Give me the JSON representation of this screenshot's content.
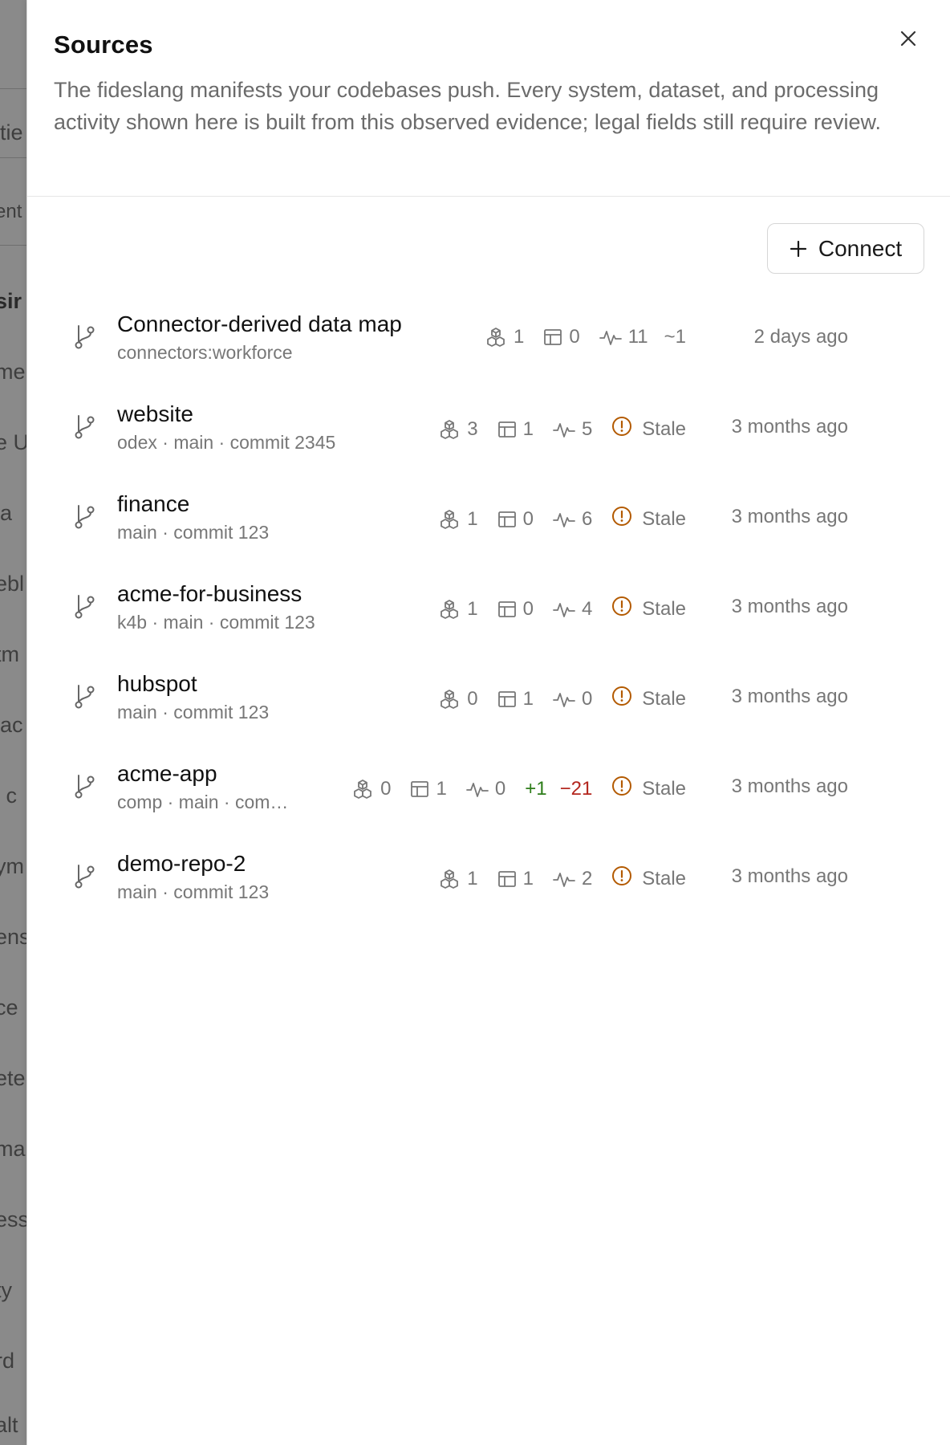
{
  "backdrop": {
    "fragments": [
      "itie",
      "ent",
      "sir",
      "me",
      "e U",
      "la ",
      "ebl",
      "tm",
      "lac",
      "l c",
      "ym",
      "ens",
      "ce ",
      "ete",
      "ma",
      "ess",
      "ty ",
      "rd ",
      "alt"
    ]
  },
  "panel": {
    "title": "Sources",
    "description": "The fideslang manifests your codebases push. Every system, dataset, and processing activity shown here is built from this observed evidence; legal fields still require review.",
    "close_icon": "close-icon",
    "connect_label": "Connect",
    "connect_icon": "plus-icon"
  },
  "colors": {
    "stale": "#b35a00",
    "plus": "#2e7d1a",
    "minus": "#b3261e",
    "muted": "#777777"
  },
  "sources": [
    {
      "name": "Connector-derived data map",
      "sub": "connectors:workforce",
      "systems": "1",
      "datasets": "0",
      "activity": "11",
      "approx": "~1",
      "stale": false,
      "time": "2 days ago"
    },
    {
      "name": "website",
      "sub": "odex · main · commit 2345",
      "systems": "3",
      "datasets": "1",
      "activity": "5",
      "stale": true,
      "stale_label": "Stale",
      "time": "3 months ago"
    },
    {
      "name": "finance",
      "sub": "main · commit 123",
      "systems": "1",
      "datasets": "0",
      "activity": "6",
      "stale": true,
      "stale_label": "Stale",
      "time": "3 months ago"
    },
    {
      "name": "acme-for-business",
      "sub": "k4b · main · commit 123",
      "systems": "1",
      "datasets": "0",
      "activity": "4",
      "stale": true,
      "stale_label": "Stale",
      "time": "3 months ago"
    },
    {
      "name": "hubspot",
      "sub": "main · commit 123",
      "systems": "0",
      "datasets": "1",
      "activity": "0",
      "stale": true,
      "stale_label": "Stale",
      "time": "3 months ago"
    },
    {
      "name": "acme-app",
      "sub": "comp · main · com…",
      "systems": "0",
      "datasets": "1",
      "activity": "0",
      "plus": "+1",
      "minus": "−21",
      "stale": true,
      "stale_label": "Stale",
      "time": "3 months ago"
    },
    {
      "name": "demo-repo-2",
      "sub": "main · commit 123",
      "systems": "1",
      "datasets": "1",
      "activity": "2",
      "stale": true,
      "stale_label": "Stale",
      "time": "3 months ago"
    }
  ]
}
